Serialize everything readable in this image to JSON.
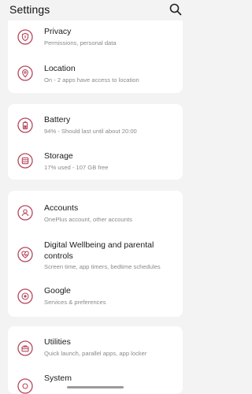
{
  "app_bar": {
    "title": "Settings",
    "search_icon": "search-icon"
  },
  "accent_color": "#b5485d",
  "groups": [
    {
      "items": [
        {
          "icon": "privacy-shield-icon",
          "title": "Privacy",
          "subtitle": "Permissions, personal data"
        },
        {
          "icon": "location-pin-icon",
          "title": "Location",
          "subtitle": "On - 2 apps have access to location"
        }
      ]
    },
    {
      "items": [
        {
          "icon": "battery-icon",
          "title": "Battery",
          "subtitle": "94% - Should last until about 20:00"
        },
        {
          "icon": "storage-icon",
          "title": "Storage",
          "subtitle": "17% used - 107 GB free"
        }
      ]
    },
    {
      "items": [
        {
          "icon": "account-icon",
          "title": "Accounts",
          "subtitle": "OnePlus account, other accounts"
        },
        {
          "icon": "digital-wellbeing-icon",
          "title": "Digital Wellbeing and parental controls",
          "subtitle": "Screen time, app timers, bedtime schedules"
        },
        {
          "icon": "google-icon",
          "title": "Google",
          "subtitle": "Services & preferences"
        }
      ]
    },
    {
      "items": [
        {
          "icon": "utilities-icon",
          "title": "Utilities",
          "subtitle": "Quick launch, parallel apps, app locker"
        },
        {
          "icon": "system-icon",
          "title": "System",
          "subtitle": ""
        }
      ]
    }
  ]
}
